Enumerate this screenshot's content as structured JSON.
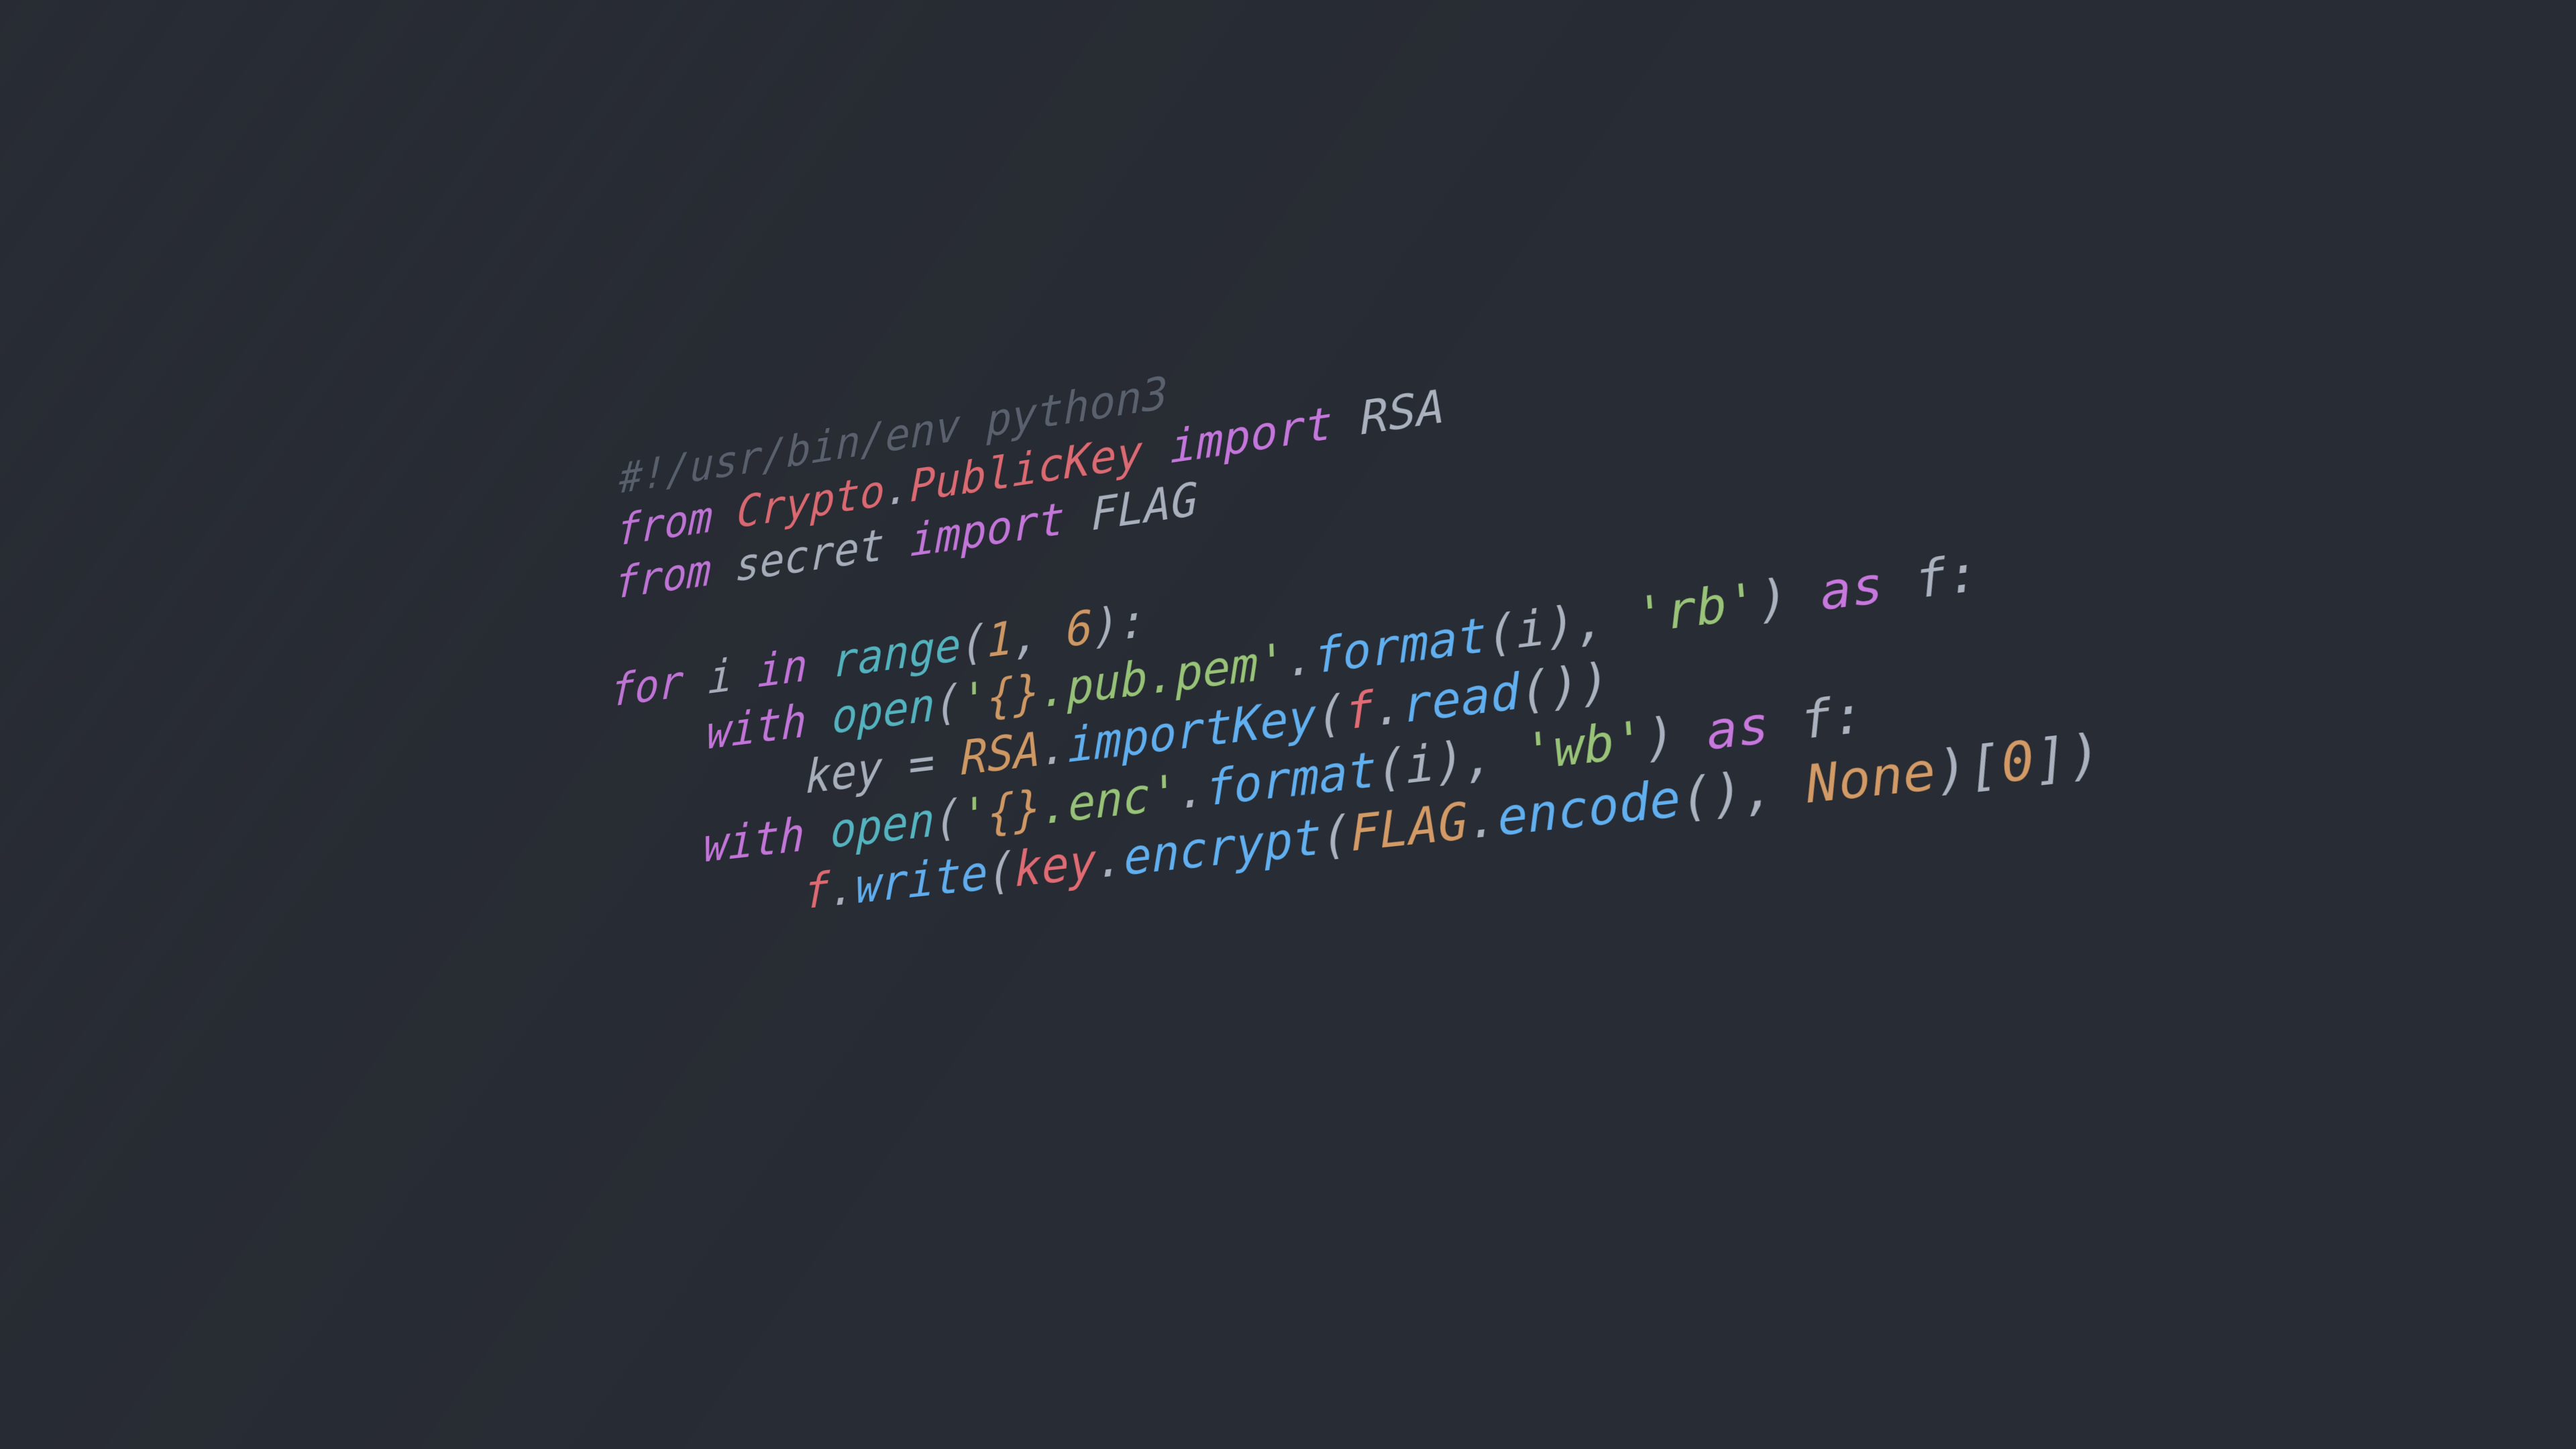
{
  "editor": {
    "background_color": "#282c34",
    "language": "python",
    "default_text_color": "#abb2bf"
  },
  "palette": {
    "comment": "#5c6370",
    "keyword": "#c678dd",
    "class_name": "#e06c75",
    "builtin": "#56b6c2",
    "function": "#61afef",
    "string": "#98c379",
    "number": "#d19a66",
    "constant": "#d19a66",
    "variable": "#e06c75",
    "punctuation": "#abb2bf"
  },
  "code": {
    "lines": [
      {
        "index": 1,
        "indent": 0,
        "text": "#!/usr/bin/env python3",
        "tokens": [
          {
            "t": "#!/usr/bin/env python3",
            "c": "tok-comment"
          }
        ]
      },
      {
        "index": 2,
        "indent": 0,
        "text": "from Crypto.PublicKey import RSA",
        "tokens": [
          {
            "t": "from",
            "c": "tok-keyword"
          },
          {
            "t": " ",
            "c": "tok-plain"
          },
          {
            "t": "Crypto",
            "c": "tok-class"
          },
          {
            "t": ".",
            "c": "tok-punct"
          },
          {
            "t": "PublicKey",
            "c": "tok-class"
          },
          {
            "t": " ",
            "c": "tok-plain"
          },
          {
            "t": "import",
            "c": "tok-keyword"
          },
          {
            "t": " ",
            "c": "tok-plain"
          },
          {
            "t": "RSA",
            "c": "tok-plain"
          }
        ]
      },
      {
        "index": 3,
        "indent": 0,
        "text": "from secret import FLAG",
        "tokens": [
          {
            "t": "from",
            "c": "tok-keyword"
          },
          {
            "t": " secret ",
            "c": "tok-plain"
          },
          {
            "t": "import",
            "c": "tok-keyword"
          },
          {
            "t": " ",
            "c": "tok-plain"
          },
          {
            "t": "FLAG",
            "c": "tok-plain"
          }
        ]
      },
      {
        "index": 4,
        "indent": 0,
        "text": "",
        "tokens": []
      },
      {
        "index": 5,
        "indent": 0,
        "text": "for i in range(1, 6):",
        "tokens": [
          {
            "t": "for",
            "c": "tok-keyword"
          },
          {
            "t": " i ",
            "c": "tok-plain"
          },
          {
            "t": "in",
            "c": "tok-keyword"
          },
          {
            "t": " ",
            "c": "tok-plain"
          },
          {
            "t": "range",
            "c": "tok-builtin"
          },
          {
            "t": "(",
            "c": "tok-punct"
          },
          {
            "t": "1",
            "c": "tok-number"
          },
          {
            "t": ", ",
            "c": "tok-punct"
          },
          {
            "t": "6",
            "c": "tok-number"
          },
          {
            "t": "):",
            "c": "tok-punct"
          }
        ]
      },
      {
        "index": 6,
        "indent": 1,
        "text": "    with open('{}.pub.pem'.format(i), 'rb') as f:",
        "tokens": [
          {
            "t": "    ",
            "c": "tok-plain"
          },
          {
            "t": "with",
            "c": "tok-keyword"
          },
          {
            "t": " ",
            "c": "tok-plain"
          },
          {
            "t": "open",
            "c": "tok-builtin"
          },
          {
            "t": "(",
            "c": "tok-punct"
          },
          {
            "t": "'",
            "c": "tok-string"
          },
          {
            "t": "{}",
            "c": "tok-brace"
          },
          {
            "t": ".pub.pem'",
            "c": "tok-string"
          },
          {
            "t": ".",
            "c": "tok-punct"
          },
          {
            "t": "format",
            "c": "tok-func"
          },
          {
            "t": "(",
            "c": "tok-punct"
          },
          {
            "t": "i",
            "c": "tok-plain"
          },
          {
            "t": "), ",
            "c": "tok-punct"
          },
          {
            "t": "'rb'",
            "c": "tok-string"
          },
          {
            "t": ") ",
            "c": "tok-punct"
          },
          {
            "t": "as",
            "c": "tok-keyword"
          },
          {
            "t": " f:",
            "c": "tok-plain"
          }
        ]
      },
      {
        "index": 7,
        "indent": 2,
        "text": "        key = RSA.importKey(f.read())",
        "tokens": [
          {
            "t": "        key = ",
            "c": "tok-plain"
          },
          {
            "t": "RSA",
            "c": "tok-const"
          },
          {
            "t": ".",
            "c": "tok-punct"
          },
          {
            "t": "importKey",
            "c": "tok-func"
          },
          {
            "t": "(",
            "c": "tok-punct"
          },
          {
            "t": "f",
            "c": "tok-var"
          },
          {
            "t": ".",
            "c": "tok-punct"
          },
          {
            "t": "read",
            "c": "tok-func"
          },
          {
            "t": "())",
            "c": "tok-punct"
          }
        ]
      },
      {
        "index": 8,
        "indent": 1,
        "text": "    with open('{}.enc'.format(i), 'wb') as f:",
        "tokens": [
          {
            "t": "    ",
            "c": "tok-plain"
          },
          {
            "t": "with",
            "c": "tok-keyword"
          },
          {
            "t": " ",
            "c": "tok-plain"
          },
          {
            "t": "open",
            "c": "tok-builtin"
          },
          {
            "t": "(",
            "c": "tok-punct"
          },
          {
            "t": "'",
            "c": "tok-string"
          },
          {
            "t": "{}",
            "c": "tok-brace"
          },
          {
            "t": ".enc'",
            "c": "tok-string"
          },
          {
            "t": ".",
            "c": "tok-punct"
          },
          {
            "t": "format",
            "c": "tok-func"
          },
          {
            "t": "(",
            "c": "tok-punct"
          },
          {
            "t": "i",
            "c": "tok-plain"
          },
          {
            "t": "), ",
            "c": "tok-punct"
          },
          {
            "t": "'wb'",
            "c": "tok-string"
          },
          {
            "t": ") ",
            "c": "tok-punct"
          },
          {
            "t": "as",
            "c": "tok-keyword"
          },
          {
            "t": " f:",
            "c": "tok-plain"
          }
        ]
      },
      {
        "index": 9,
        "indent": 2,
        "text": "        f.write(key.encrypt(FLAG.encode(), None)[0])",
        "tokens": [
          {
            "t": "        ",
            "c": "tok-plain"
          },
          {
            "t": "f",
            "c": "tok-var"
          },
          {
            "t": ".",
            "c": "tok-punct"
          },
          {
            "t": "write",
            "c": "tok-func"
          },
          {
            "t": "(",
            "c": "tok-punct"
          },
          {
            "t": "key",
            "c": "tok-var"
          },
          {
            "t": ".",
            "c": "tok-punct"
          },
          {
            "t": "encrypt",
            "c": "tok-func"
          },
          {
            "t": "(",
            "c": "tok-punct"
          },
          {
            "t": "FLAG",
            "c": "tok-const"
          },
          {
            "t": ".",
            "c": "tok-punct"
          },
          {
            "t": "encode",
            "c": "tok-func"
          },
          {
            "t": "(), ",
            "c": "tok-punct"
          },
          {
            "t": "None",
            "c": "tok-const"
          },
          {
            "t": ")[",
            "c": "tok-punct"
          },
          {
            "t": "0",
            "c": "tok-number"
          },
          {
            "t": "])",
            "c": "tok-punct"
          }
        ]
      }
    ]
  }
}
